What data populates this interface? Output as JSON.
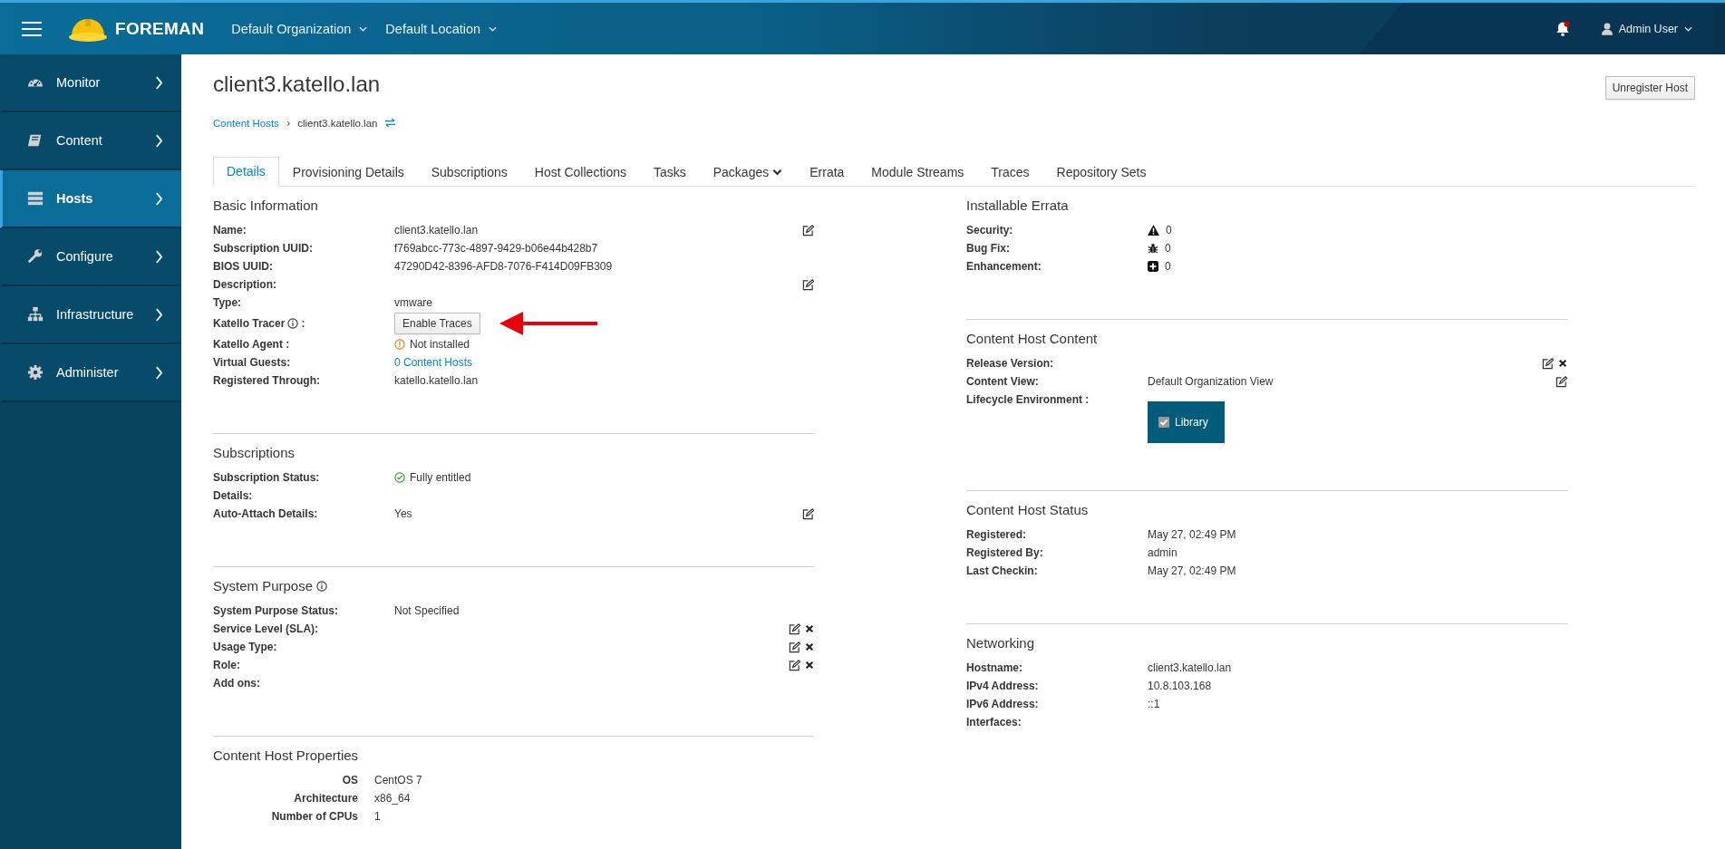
{
  "header": {
    "brand": "FOREMAN",
    "context": [
      {
        "label": "Default Organization"
      },
      {
        "label": "Default Location"
      }
    ],
    "notifications": {
      "unread": true
    },
    "user": "Admin User"
  },
  "sidebar": {
    "items": [
      {
        "label": "Monitor",
        "kind": "monitor",
        "selected": false
      },
      {
        "label": "Content",
        "kind": "content",
        "selected": false
      },
      {
        "label": "Hosts",
        "kind": "hosts",
        "selected": true
      },
      {
        "label": "Configure",
        "kind": "configure",
        "selected": false
      },
      {
        "label": "Infrastructure",
        "kind": "infrastructure",
        "selected": false
      },
      {
        "label": "Administer",
        "kind": "administer",
        "selected": false
      }
    ]
  },
  "page": {
    "title": "client3.katello.lan",
    "action": "Unregister Host",
    "breadcrumb": [
      {
        "label": "Content Hosts",
        "link": true
      },
      {
        "separator": "›",
        "label": "client3.katello.lan",
        "link": false
      }
    ],
    "tabs": [
      {
        "label": "Details",
        "selected": true,
        "dropdown": false
      },
      {
        "label": "Provisioning Details",
        "selected": false,
        "dropdown": false
      },
      {
        "label": "Subscriptions",
        "selected": false,
        "dropdown": false
      },
      {
        "label": "Host Collections",
        "selected": false,
        "dropdown": false
      },
      {
        "label": "Tasks",
        "selected": false,
        "dropdown": false
      },
      {
        "label": "Packages",
        "selected": false,
        "dropdown": true
      },
      {
        "label": "Errata",
        "selected": false,
        "dropdown": false
      },
      {
        "label": "Module Streams",
        "selected": false,
        "dropdown": false
      },
      {
        "label": "Traces",
        "selected": false,
        "dropdown": false
      },
      {
        "label": "Repository Sets",
        "selected": false,
        "dropdown": false
      }
    ]
  },
  "columns": [
    [
      {
        "title": "Basic Information",
        "info": false,
        "kind": "fields",
        "rows": [
          {
            "label": "Name:",
            "value": "client3.katello.lan",
            "kind": "text",
            "editable": true,
            "removable": false,
            "annotated": false
          },
          {
            "label": "Subscription UUID:",
            "value": "f769abcc-773c-4897-9429-b06e44b428b7",
            "kind": "text",
            "editable": false,
            "removable": false,
            "annotated": false
          },
          {
            "label": "BIOS UUID:",
            "value": "47290D42-8396-AFD8-7076-F414D09FB309",
            "kind": "text",
            "editable": false,
            "removable": false,
            "annotated": false
          },
          {
            "label": "Description:",
            "kind": "text",
            "editable": true,
            "removable": false,
            "annotated": false
          },
          {
            "label": "Type:",
            "value": "vmware",
            "kind": "text",
            "editable": false,
            "removable": false,
            "annotated": false
          },
          {
            "label": "Katello Tracer",
            "info": true,
            "suffix": ":",
            "value": "Enable Traces",
            "kind": "button",
            "editable": false,
            "removable": false,
            "annotated": true
          },
          {
            "label": "Katello Agent :",
            "value": "Not installed",
            "kind": "warning",
            "editable": false,
            "removable": false,
            "annotated": false
          },
          {
            "label": "Virtual Guests:",
            "value": "0 Content Hosts",
            "kind": "link",
            "editable": false,
            "removable": false,
            "annotated": false
          },
          {
            "label": "Registered Through:",
            "value": "katello.katello.lan",
            "kind": "text",
            "editable": false,
            "removable": false,
            "annotated": false
          }
        ]
      },
      {
        "title": "Subscriptions",
        "info": false,
        "kind": "fields",
        "rows": [
          {
            "label": "Subscription Status:",
            "value": "Fully entitled",
            "kind": "ok",
            "editable": false,
            "removable": false,
            "annotated": false
          },
          {
            "label": "Details:",
            "kind": "text",
            "editable": false,
            "removable": false,
            "annotated": false
          },
          {
            "label": "Auto-Attach Details:",
            "value": "Yes",
            "kind": "text",
            "editable": true,
            "removable": false,
            "annotated": false
          }
        ]
      },
      {
        "title": "System Purpose",
        "info": true,
        "kind": "fields",
        "rows": [
          {
            "label": "System Purpose Status:",
            "value": "Not Specified",
            "kind": "text",
            "editable": false,
            "removable": false,
            "annotated": false
          },
          {
            "label": "Service Level (SLA):",
            "kind": "text",
            "editable": true,
            "removable": true,
            "annotated": false
          },
          {
            "label": "Usage Type:",
            "kind": "text",
            "editable": true,
            "removable": true,
            "annotated": false
          },
          {
            "label": "Role:",
            "kind": "text",
            "editable": true,
            "removable": true,
            "annotated": false
          },
          {
            "label": "Add ons:",
            "kind": "text",
            "editable": false,
            "removable": false,
            "annotated": false
          }
        ]
      },
      {
        "title": "Content Host Properties",
        "info": false,
        "kind": "properties",
        "rows": [
          {
            "label": "OS",
            "value": "CentOS 7"
          },
          {
            "label": "Architecture",
            "value": "x86_64"
          },
          {
            "label": "Number of CPUs",
            "value": "1"
          }
        ]
      }
    ],
    [
      {
        "title": "Installable Errata",
        "info": false,
        "kind": "fields",
        "rows": [
          {
            "label": "Security:",
            "value": "0",
            "kind": "security",
            "editable": false,
            "removable": false,
            "annotated": false
          },
          {
            "label": "Bug Fix:",
            "value": "0",
            "kind": "bugfix",
            "editable": false,
            "removable": false,
            "annotated": false
          },
          {
            "label": "Enhancement:",
            "value": "0",
            "kind": "enhancement",
            "editable": false,
            "removable": false,
            "annotated": false
          }
        ]
      },
      {
        "title": "Content Host Content",
        "info": false,
        "kind": "fields",
        "rows": [
          {
            "label": "Release Version:",
            "kind": "text",
            "editable": true,
            "removable": true,
            "annotated": false
          },
          {
            "label": "Content View:",
            "value": "Default Organization View",
            "kind": "text",
            "editable": true,
            "removable": false,
            "annotated": false
          },
          {
            "label": "Lifecycle Environment :",
            "kind": "environments",
            "environments": [
              {
                "label": "Library",
                "checked": true
              }
            ],
            "editable": false,
            "removable": false,
            "annotated": false
          }
        ]
      },
      {
        "title": "Content Host Status",
        "info": false,
        "kind": "fields",
        "rows": [
          {
            "label": "Registered:",
            "value": "May 27, 02:49 PM",
            "kind": "text",
            "editable": false,
            "removable": false,
            "annotated": false
          },
          {
            "label": "Registered By:",
            "value": "admin",
            "kind": "text",
            "editable": false,
            "removable": false,
            "annotated": false
          },
          {
            "label": "Last Checkin:",
            "value": "May 27, 02:49 PM",
            "kind": "text",
            "editable": false,
            "removable": false,
            "annotated": false
          }
        ]
      },
      {
        "title": "Networking",
        "info": false,
        "kind": "fields",
        "rows": [
          {
            "label": "Hostname:",
            "value": "client3.katello.lan",
            "kind": "text",
            "editable": false,
            "removable": false,
            "annotated": false
          },
          {
            "label": "IPv4 Address:",
            "value": "10.8.103.168",
            "kind": "text",
            "editable": false,
            "removable": false,
            "annotated": false
          },
          {
            "label": "IPv6 Address:",
            "value": "::1",
            "kind": "text",
            "editable": false,
            "removable": false,
            "annotated": false
          },
          {
            "label": "Interfaces:",
            "kind": "text",
            "editable": false,
            "removable": false,
            "annotated": false
          }
        ]
      }
    ]
  ]
}
